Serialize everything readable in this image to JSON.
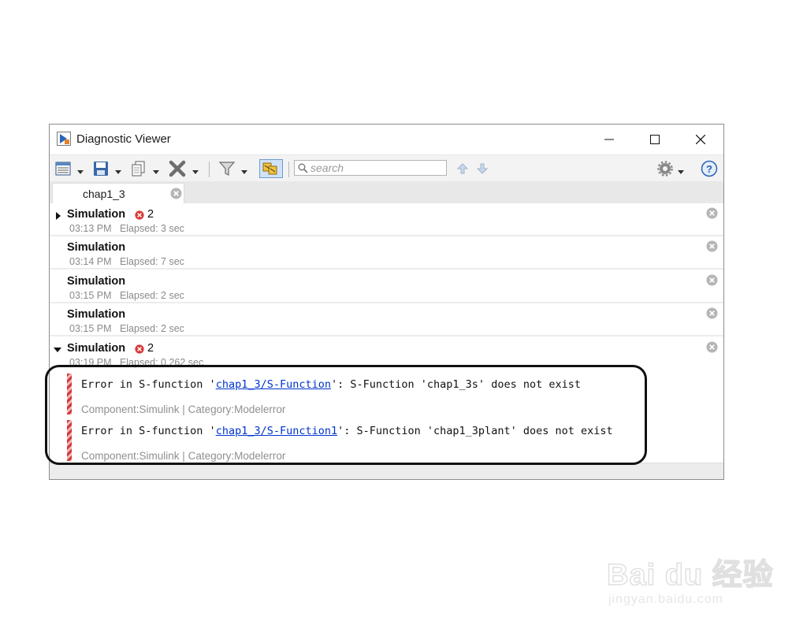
{
  "window": {
    "title": "Diagnostic Viewer"
  },
  "toolbar": {
    "search_placeholder": "search"
  },
  "tabs": [
    {
      "label": "chap1_3"
    }
  ],
  "runs": [
    {
      "title": "Simulation",
      "time": "03:13 PM",
      "elapsed": "Elapsed: 3 sec",
      "error_count": "2",
      "expanded": false
    },
    {
      "title": "Simulation",
      "time": "03:14 PM",
      "elapsed": "Elapsed: 7 sec"
    },
    {
      "title": "Simulation",
      "time": "03:15 PM",
      "elapsed": "Elapsed: 2 sec"
    },
    {
      "title": "Simulation",
      "time": "03:15 PM",
      "elapsed": "Elapsed: 2 sec"
    },
    {
      "title": "Simulation",
      "time": "03:19 PM",
      "elapsed": "Elapsed: 0.262 sec",
      "error_count": "2",
      "expanded": true
    }
  ],
  "messages": [
    {
      "prefix": "Error in S-function '",
      "link": "chap1_3/S-Function",
      "suffix": "': S-Function 'chap1_3s' does not exist",
      "meta": "Component:Simulink | Category:Modelerror"
    },
    {
      "prefix": "Error in S-function '",
      "link": "chap1_3/S-Function1",
      "suffix": "': S-Function 'chap1_3plant' does not exist",
      "meta": "Component:Simulink | Category:Modelerror"
    }
  ],
  "watermark": {
    "brand": "Bai du 经验",
    "url": "jingyan.baidu.com"
  },
  "colors": {
    "error_red": "#d23a3a",
    "link_blue": "#0033cc",
    "muted_text": "#8a8a8a"
  }
}
